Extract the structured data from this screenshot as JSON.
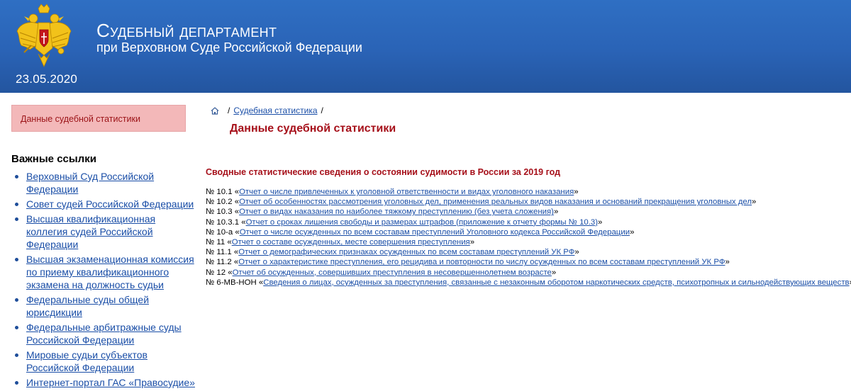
{
  "header": {
    "date": "23.05.2020",
    "title": "Судебный департамент",
    "subtitle": "при Верховном Суде Российской Федерации",
    "emblem_icon": "double-headed-eagle-emblem",
    "colors": {
      "header_bg": "#2a63b6",
      "accent_red": "#a6101a",
      "link": "#1a4ea7",
      "active_bg": "#f3b8b9"
    }
  },
  "sidebar": {
    "active_item": "Данные судебной статистики",
    "links_heading": "Важные ссылки",
    "links": [
      {
        "label": "Верховный Суд Российской Федерации"
      },
      {
        "label": "Совет судей Российской Федерации"
      },
      {
        "label": "Высшая квалификационная коллегия судей Российской Федерации"
      },
      {
        "label": "Высшая экзаменационная комиссия по приему квалификационного экзамена на должность судьи"
      },
      {
        "label": "Федеральные суды общей юрисдикции"
      },
      {
        "label": "Федеральные арбитражные суды Российской Федерации"
      },
      {
        "label": "Мировые судьи субъектов Российской Федерации"
      },
      {
        "label": "Интернет-портал ГАС «Правосудие»"
      }
    ]
  },
  "breadcrumb": {
    "home_icon": "home-icon",
    "items": [
      {
        "label": "Судебная статистика"
      }
    ],
    "separator": "/"
  },
  "main": {
    "page_title": "Данные судебной статистики",
    "section_title": "Сводные статистические сведения о состоянии судимости в России за 2019 год",
    "reports": [
      {
        "number": "№ 10.1",
        "title": "Отчет о числе привлеченных к уголовной ответственности и видах уголовного наказания"
      },
      {
        "number": "№ 10.2",
        "title": "Отчет об особенностях рассмотрения уголовных дел, применения реальных видов наказания и оснований прекращения уголовных дел"
      },
      {
        "number": "№ 10.3",
        "title": "Отчет о видах наказания по наиболее тяжкому преступлению (без учета сложения)"
      },
      {
        "number": "№ 10.3.1",
        "title": "Отчет о сроках лишения свободы и размерах штрафов (приложение к отчету формы № 10.3)"
      },
      {
        "number": "№ 10-а",
        "title": "Отчет о числе осужденных по всем составам преступлений Уголовного кодекса Российской Федерации"
      },
      {
        "number": "№ 11",
        "title": "Отчет о составе осужденных, месте совершения преступления"
      },
      {
        "number": "№ 11.1",
        "title": "Отчет о демографических признаках осужденных по всем составам преступлений УК РФ"
      },
      {
        "number": "№ 11.2",
        "title": "Отчет о характеристике преступления, его рецидива и повторности по числу осужденных по всем составам преступлений УК РФ"
      },
      {
        "number": "№ 12",
        "title": "Отчет об осужденных, совершивших преступления в несовершеннолетнем возрасте"
      },
      {
        "number": "№ 6-МВ-НОН",
        "title": "Сведения о лицах, осужденных за преступления, связанные с незаконным оборотом наркотических средств, психотропных и сильнодействующих веществ"
      }
    ]
  }
}
